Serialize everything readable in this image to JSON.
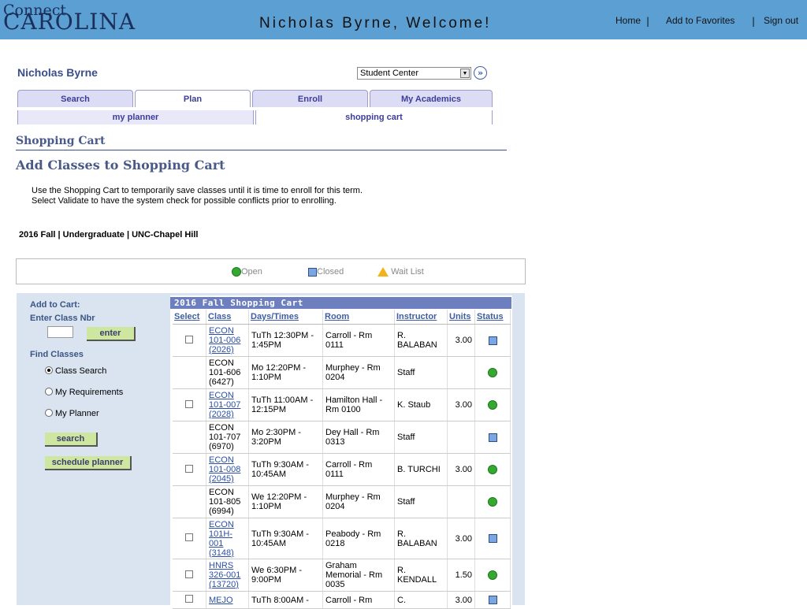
{
  "header": {
    "logo_line1": "Connect",
    "logo_line2": "CAROLINA",
    "welcome": "Nicholas Byrne, Welcome!",
    "links": {
      "home": "Home",
      "favorites": "Add to Favorites",
      "signout": "Sign out"
    }
  },
  "user": {
    "name": "Nicholas Byrne"
  },
  "nav_select": {
    "value": "Student Center",
    "arrow_icon": "chevron-down-icon",
    "go_icon": "double-chevron-right-icon"
  },
  "tabs": [
    {
      "label": "Search"
    },
    {
      "label": "Plan"
    },
    {
      "label": "Enroll"
    },
    {
      "label": "My Academics"
    }
  ],
  "subtabs": [
    {
      "label": "my planner"
    },
    {
      "label": "shopping cart"
    }
  ],
  "page": {
    "section_title": "Shopping Cart",
    "title": "Add Classes to Shopping Cart",
    "intro_line1": "Use the Shopping Cart to temporarily save classes until it is time to enroll for this term.",
    "intro_line2": "Select Validate to have the system check for possible conflicts prior to enrolling.",
    "term": "2016 Fall | Undergraduate | UNC-Chapel Hill"
  },
  "legend": {
    "open": "Open",
    "closed": "Closed",
    "waitlist": "Wait List"
  },
  "colors": {
    "open": "#35a831",
    "closed": "#7aa7e0",
    "waitlist": "#f2b21e",
    "header_bar": "#5c9fd3"
  },
  "sidebar": {
    "add_to_cart": "Add to Cart:",
    "enter_class_nbr": "Enter Class Nbr",
    "enter_button": "enter",
    "find_classes": "Find Classes",
    "options": [
      "Class Search",
      "My Requirements",
      "My Planner"
    ],
    "selected_option": "Class Search",
    "search_button": "search",
    "schedule_planner_button": "schedule planner"
  },
  "cart": {
    "title": "2016 Fall Shopping Cart",
    "columns": [
      "Select",
      "Class",
      "Days/Times",
      "Room",
      "Instructor",
      "Units",
      "Status"
    ],
    "rows": [
      {
        "select": true,
        "class1": "ECON",
        "class2": "101-006",
        "class3": "(2026)",
        "link": true,
        "days1": "TuTh 12:30PM -",
        "days2": "1:45PM",
        "room1": "Carroll - Rm",
        "room2": "0111",
        "inst1": "R.",
        "inst2": "BALABAN",
        "units": "3.00",
        "status": "closed"
      },
      {
        "select": false,
        "class1": "ECON",
        "class2": "101-606",
        "class3": "(6427)",
        "link": false,
        "days1": "Mo 12:20PM -",
        "days2": "1:10PM",
        "room1": "Murphey - Rm",
        "room2": "0204",
        "inst1": "Staff",
        "inst2": "",
        "units": "",
        "status": "open"
      },
      {
        "select": true,
        "class1": "ECON",
        "class2": "101-007",
        "class3": "(2028)",
        "link": true,
        "days1": "TuTh 11:00AM -",
        "days2": "12:15PM",
        "room1": "Hamilton Hall -",
        "room2": "Rm 0100",
        "inst1": "K. Staub",
        "inst2": "",
        "units": "3.00",
        "status": "open"
      },
      {
        "select": false,
        "class1": "ECON",
        "class2": "101-707",
        "class3": "(6970)",
        "link": false,
        "days1": "Mo 2:30PM -",
        "days2": "3:20PM",
        "room1": "Dey Hall - Rm",
        "room2": "0313",
        "inst1": "Staff",
        "inst2": "",
        "units": "",
        "status": "closed"
      },
      {
        "select": true,
        "class1": "ECON",
        "class2": "101-008",
        "class3": "(2045)",
        "link": true,
        "days1": "TuTh 9:30AM -",
        "days2": "10:45AM",
        "room1": "Carroll - Rm",
        "room2": "0111",
        "inst1": "B. TURCHI",
        "inst2": "",
        "units": "3.00",
        "status": "open"
      },
      {
        "select": false,
        "class1": "ECON",
        "class2": "101-805",
        "class3": "(6994)",
        "link": false,
        "days1": "We 12:20PM -",
        "days2": "1:10PM",
        "room1": "Murphey - Rm",
        "room2": "0204",
        "inst1": "Staff",
        "inst2": "",
        "units": "",
        "status": "open"
      },
      {
        "select": true,
        "class1": "ECON",
        "class2": "101H-",
        "class3": "001",
        "class4": "(3148)",
        "link": true,
        "days1": "TuTh 9:30AM -",
        "days2": "10:45AM",
        "room1": "Peabody - Rm",
        "room2": "0218",
        "inst1": "R.",
        "inst2": "BALABAN",
        "units": "3.00",
        "status": "closed"
      },
      {
        "select": true,
        "class1": "HNRS",
        "class2": "326-001",
        "class3": "(13720)",
        "link": true,
        "days1": "We 6:30PM -",
        "days2": "9:00PM",
        "room1": "Graham",
        "room2": "Memorial - Rm",
        "room3": "0035",
        "inst1": "R.",
        "inst2": "KENDALL",
        "units": "1.50",
        "status": "open"
      },
      {
        "select": true,
        "class1": "MEJO",
        "class2": "",
        "class3": "",
        "link": true,
        "days1": "TuTh 8:00AM -",
        "days2": "",
        "room1": "Carroll - Rm",
        "room2": "",
        "inst1": "C.",
        "inst2": "",
        "units": "3.00",
        "status": "closed"
      }
    ]
  }
}
